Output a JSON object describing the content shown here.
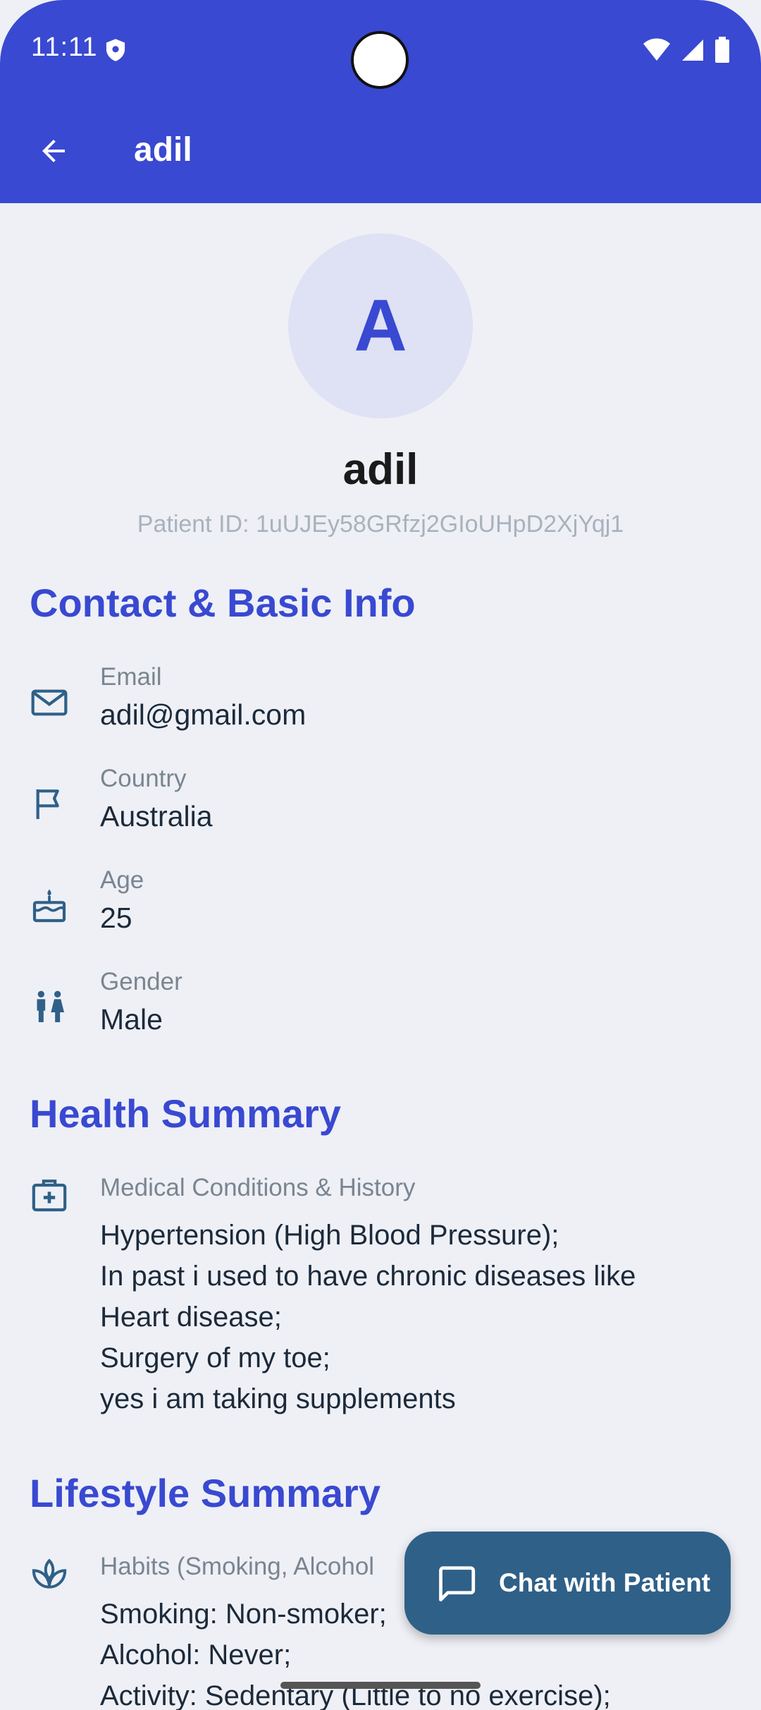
{
  "status_bar": {
    "time": "11:11"
  },
  "appbar": {
    "title": "adil"
  },
  "profile": {
    "initial": "A",
    "name": "adil",
    "patient_id": "Patient ID: 1uUJEy58GRfzj2GIoUHpD2XjYqj1"
  },
  "sections": {
    "contact_title": "Contact & Basic Info",
    "health_title": "Health Summary",
    "lifestyle_title": "Lifestyle Summary"
  },
  "contact": {
    "email": {
      "label": "Email",
      "value": "adil@gmail.com",
      "icon": "mail-icon"
    },
    "country": {
      "label": "Country",
      "value": "Australia",
      "icon": "flag-icon"
    },
    "age": {
      "label": "Age",
      "value": "25",
      "icon": "cake-icon"
    },
    "gender": {
      "label": "Gender",
      "value": "Male",
      "icon": "people-icon"
    }
  },
  "health": {
    "label": "Medical Conditions & History",
    "icon": "medical-kit-icon",
    "lines": [
      "Hypertension (High Blood Pressure);",
      "In past i used to have chronic diseases like",
      "Heart disease;",
      "Surgery of my toe;",
      "yes i am taking supplements"
    ]
  },
  "lifestyle": {
    "label": "Habits (Smoking, Alcohol",
    "icon": "spa-icon",
    "lines": [
      "Smoking: Non-smoker;",
      "Alcohol: Never;",
      "Activity: Sedentary (Little to no exercise);"
    ]
  },
  "fab": {
    "label": "Chat with Patient",
    "icon": "chat-icon"
  },
  "colors": {
    "primary": "#3949d1",
    "fab": "#2f6088",
    "background": "#eef0f6"
  }
}
